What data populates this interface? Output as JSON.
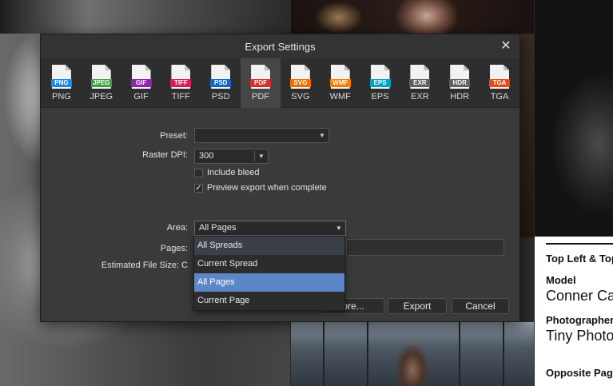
{
  "background": {
    "caption_heading_1": "Top Left & Top",
    "caption_heading_2": "Model",
    "caption_value_2": "Conner Ca",
    "caption_heading_3": "Photographer",
    "caption_value_3": "Tiny Photo",
    "caption_heading_4": "Opposite Page"
  },
  "dialog": {
    "title": "Export Settings",
    "close_glyph": "✕",
    "formats": [
      {
        "label": "PNG",
        "badge": "PNG",
        "color": "#1e88e5"
      },
      {
        "label": "JPEG",
        "badge": "JPEG",
        "color": "#43a047"
      },
      {
        "label": "GIF",
        "badge": "GIF",
        "color": "#8e24aa"
      },
      {
        "label": "TIFF",
        "badge": "TIFF",
        "color": "#d81b60"
      },
      {
        "label": "PSD",
        "badge": "PSD",
        "color": "#1565c0"
      },
      {
        "label": "PDF",
        "badge": "PDF",
        "color": "#d32f2f"
      },
      {
        "label": "SVG",
        "badge": "SVG",
        "color": "#ef6c00"
      },
      {
        "label": "WMF",
        "badge": "WMF",
        "color": "#f57c00"
      },
      {
        "label": "EPS",
        "badge": "EPS",
        "color": "#00a3c4"
      },
      {
        "label": "EXR",
        "badge": "EXR",
        "color": "#616161"
      },
      {
        "label": "HDR",
        "badge": "HDR",
        "color": "#616161"
      },
      {
        "label": "TGA",
        "badge": "TGA",
        "color": "#e64a19"
      }
    ],
    "selected_format": "PDF",
    "preset_label": "Preset:",
    "preset_value": "",
    "raster_dpi_label": "Raster DPI:",
    "raster_dpi_value": "300",
    "include_bleed_label": "Include bleed",
    "include_bleed_checked": false,
    "preview_label": "Preview export when complete",
    "preview_checked": true,
    "area_label": "Area:",
    "area_value": "All Pages",
    "pages_label": "Pages:",
    "file_size_label": "Estimated File Size: C",
    "more_button": "ore...",
    "export_button": "Export",
    "cancel_button": "Cancel",
    "area_options": [
      "All Spreads",
      "Current Spread",
      "All Pages",
      "Current Page"
    ],
    "area_hover_index": 0,
    "area_selected_index": 2,
    "checkmark": "✓",
    "arrow_glyph": "▼"
  }
}
